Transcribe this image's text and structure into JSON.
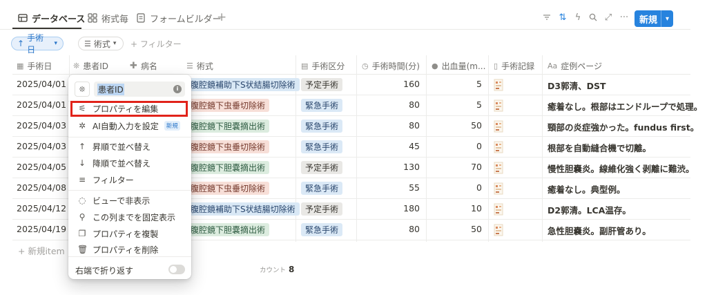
{
  "tabs": [
    {
      "label": "データベース",
      "icon": "table-icon",
      "active": true
    },
    {
      "label": "術式毎",
      "icon": "grid-icon",
      "active": false
    },
    {
      "label": "フォームビルダー",
      "icon": "form-icon",
      "active": false
    }
  ],
  "toolbar": {
    "new_label": "新規",
    "accent": "#2783de"
  },
  "filter_row": {
    "sort_chip": "手術日",
    "prop_chip": "術式",
    "add_filter": "+ フィルター"
  },
  "columns": [
    {
      "label": "手術日",
      "icon": "calendar-icon"
    },
    {
      "label": "患者ID",
      "icon": "sparkle-icon"
    },
    {
      "label": "病名",
      "icon": "cross-icon"
    },
    {
      "label": "術式",
      "icon": "list-icon"
    },
    {
      "label": "手術区分",
      "icon": "select-icon"
    },
    {
      "label": "手術時間(分)",
      "icon": "clock-icon"
    },
    {
      "label": "出血量(m...",
      "icon": "drop-icon"
    },
    {
      "label": "手術記録",
      "icon": "file-icon"
    },
    {
      "label": "症例ページ",
      "icon": "text-icon"
    }
  ],
  "rows": [
    {
      "date": "2025/04/01",
      "procedure": "腹腔鏡補助下S状結腸切除術",
      "proc_color": "blue",
      "category": "予定手術",
      "cat_color": "gray",
      "time": "160",
      "blood": "5",
      "case": "D3郭清、DST"
    },
    {
      "date": "2025/04/01",
      "procedure": "腹腔鏡下虫垂切除術",
      "proc_color": "red",
      "category": "緊急手術",
      "cat_color": "lblue",
      "time": "80",
      "blood": "5",
      "case": "癒着なし。根部はエンドループで処理。"
    },
    {
      "date": "2025/04/03",
      "procedure": "腹腔鏡下胆嚢摘出術",
      "proc_color": "green",
      "category": "緊急手術",
      "cat_color": "lblue",
      "time": "80",
      "blood": "50",
      "case": "頸部の炎症強かった。fundus first。"
    },
    {
      "date": "2025/04/03",
      "procedure": "腹腔鏡下虫垂切除術",
      "proc_color": "red",
      "category": "緊急手術",
      "cat_color": "lblue",
      "time": "45",
      "blood": "0",
      "case": "根部を自動縫合機で切離。"
    },
    {
      "date": "2025/04/05",
      "procedure": "腹腔鏡下胆嚢摘出術",
      "proc_color": "green",
      "category": "予定手術",
      "cat_color": "gray",
      "time": "130",
      "blood": "70",
      "case": "慢性胆嚢炎。線維化強く剥離に難渋。"
    },
    {
      "date": "2025/04/08",
      "procedure": "腹腔鏡下虫垂切除術",
      "proc_color": "red",
      "category": "緊急手術",
      "cat_color": "lblue",
      "time": "55",
      "blood": "0",
      "case": "癒着なし。典型例。"
    },
    {
      "date": "2025/04/12",
      "procedure": "腹腔鏡補助下S状結腸切除術",
      "proc_color": "blue",
      "category": "予定手術",
      "cat_color": "gray",
      "time": "180",
      "blood": "10",
      "case": "D2郭清。LCA温存。"
    },
    {
      "date": "2025/04/19",
      "procedure": "腹腔鏡下胆嚢摘出術",
      "proc_color": "green",
      "category": "緊急手術",
      "cat_color": "lblue",
      "time": "80",
      "blood": "50",
      "case": "急性胆嚢炎。副肝管あり。"
    }
  ],
  "footer": {
    "new_item": "+ 新規item",
    "count_label": "カウント",
    "count_value": "8"
  },
  "menu": {
    "property_name": "患者ID",
    "items": [
      {
        "label": "プロパティを編集",
        "icon": "sliders-icon"
      },
      {
        "label": "AI自動入力を設定",
        "icon": "ai-sparkle-icon",
        "badge": "新規"
      },
      {
        "label": "昇順で並べ替え",
        "icon": "arrow-up-icon"
      },
      {
        "label": "降順で並べ替え",
        "icon": "arrow-down-icon"
      },
      {
        "label": "フィルター",
        "icon": "filter-icon"
      },
      {
        "label": "ビューで非表示",
        "icon": "eye-off-icon"
      },
      {
        "label": "この列までを固定表示",
        "icon": "pin-icon"
      },
      {
        "label": "プロパティを複製",
        "icon": "copy-icon"
      },
      {
        "label": "プロパティを削除",
        "icon": "trash-icon"
      }
    ],
    "wrap_label": "右端で折り返す"
  }
}
